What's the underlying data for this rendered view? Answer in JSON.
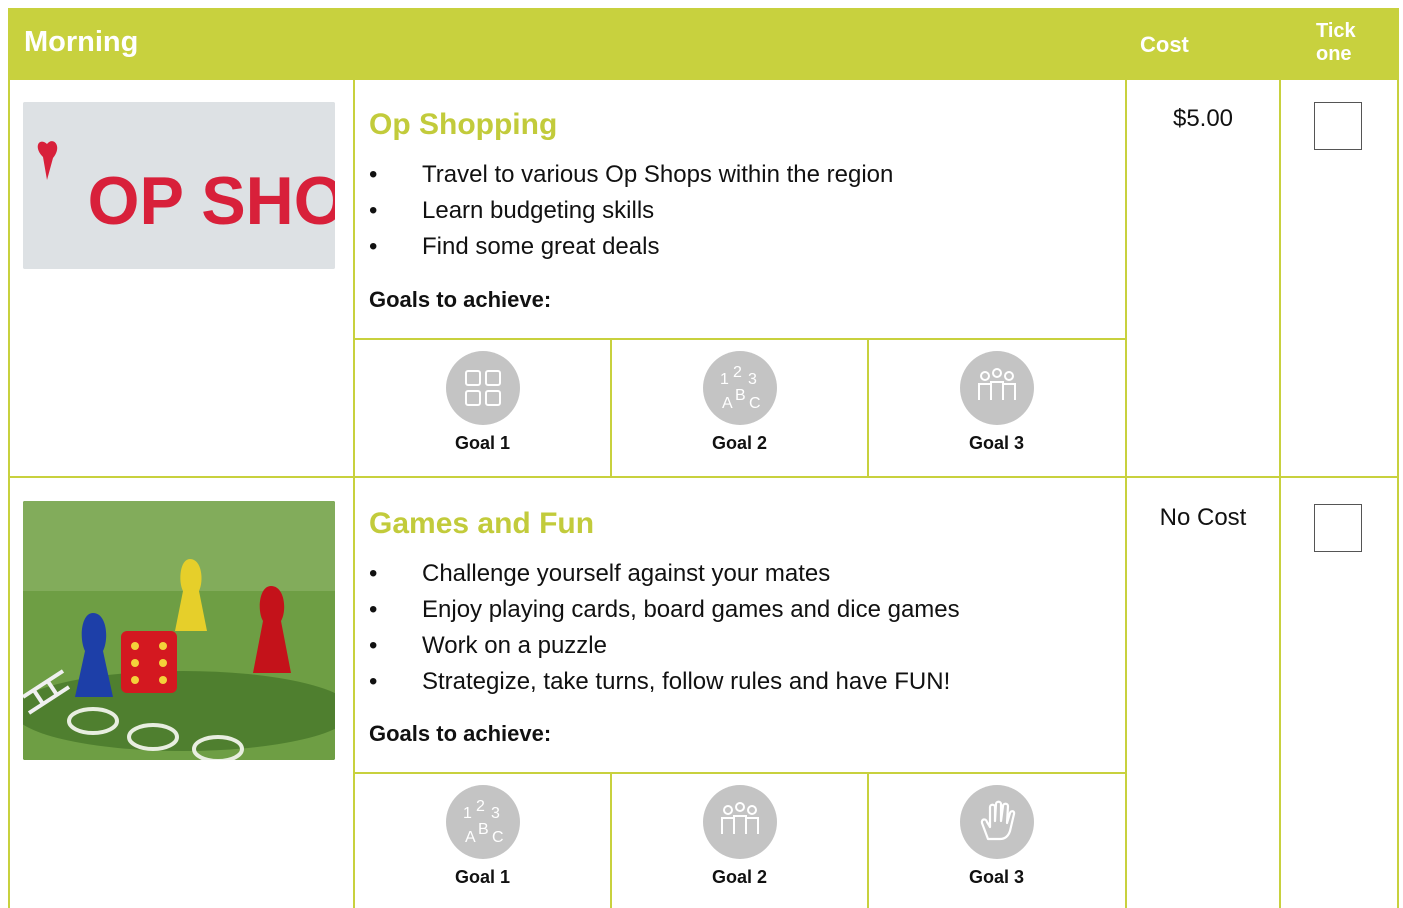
{
  "header": {
    "title": "Morning",
    "cost_label": "Cost",
    "tick_line1": "Tick",
    "tick_line2": "one"
  },
  "activities": [
    {
      "title": "Op Shopping",
      "image_text": "OP SHOP",
      "bullets": [
        "Travel to various Op Shops within the region",
        "Learn budgeting skills",
        "Find some great deals"
      ],
      "goals_label": "Goals to achieve:",
      "goals": [
        {
          "label": "Goal 1",
          "icon": "teamwork-hands-icon"
        },
        {
          "label": "Goal 2",
          "icon": "numbers-letters-icon"
        },
        {
          "label": "Goal 3",
          "icon": "group-people-icon"
        }
      ],
      "cost": "$5.00"
    },
    {
      "title": "Games and Fun",
      "bullets": [
        "Challenge yourself against your mates",
        "Enjoy playing cards, board games and dice games",
        "Work on a puzzle",
        "Strategize, take turns, follow rules and have FUN!"
      ],
      "goals_label": "Goals to achieve:",
      "goals": [
        {
          "label": "Goal 1",
          "icon": "numbers-letters-icon"
        },
        {
          "label": "Goal 2",
          "icon": "group-people-icon"
        },
        {
          "label": "Goal 3",
          "icon": "hand-icon"
        }
      ],
      "cost": "No Cost"
    }
  ],
  "colors": {
    "accent": "#c8d13e",
    "title": "#c2cb3b",
    "icon_bg": "#c4c4c4"
  }
}
